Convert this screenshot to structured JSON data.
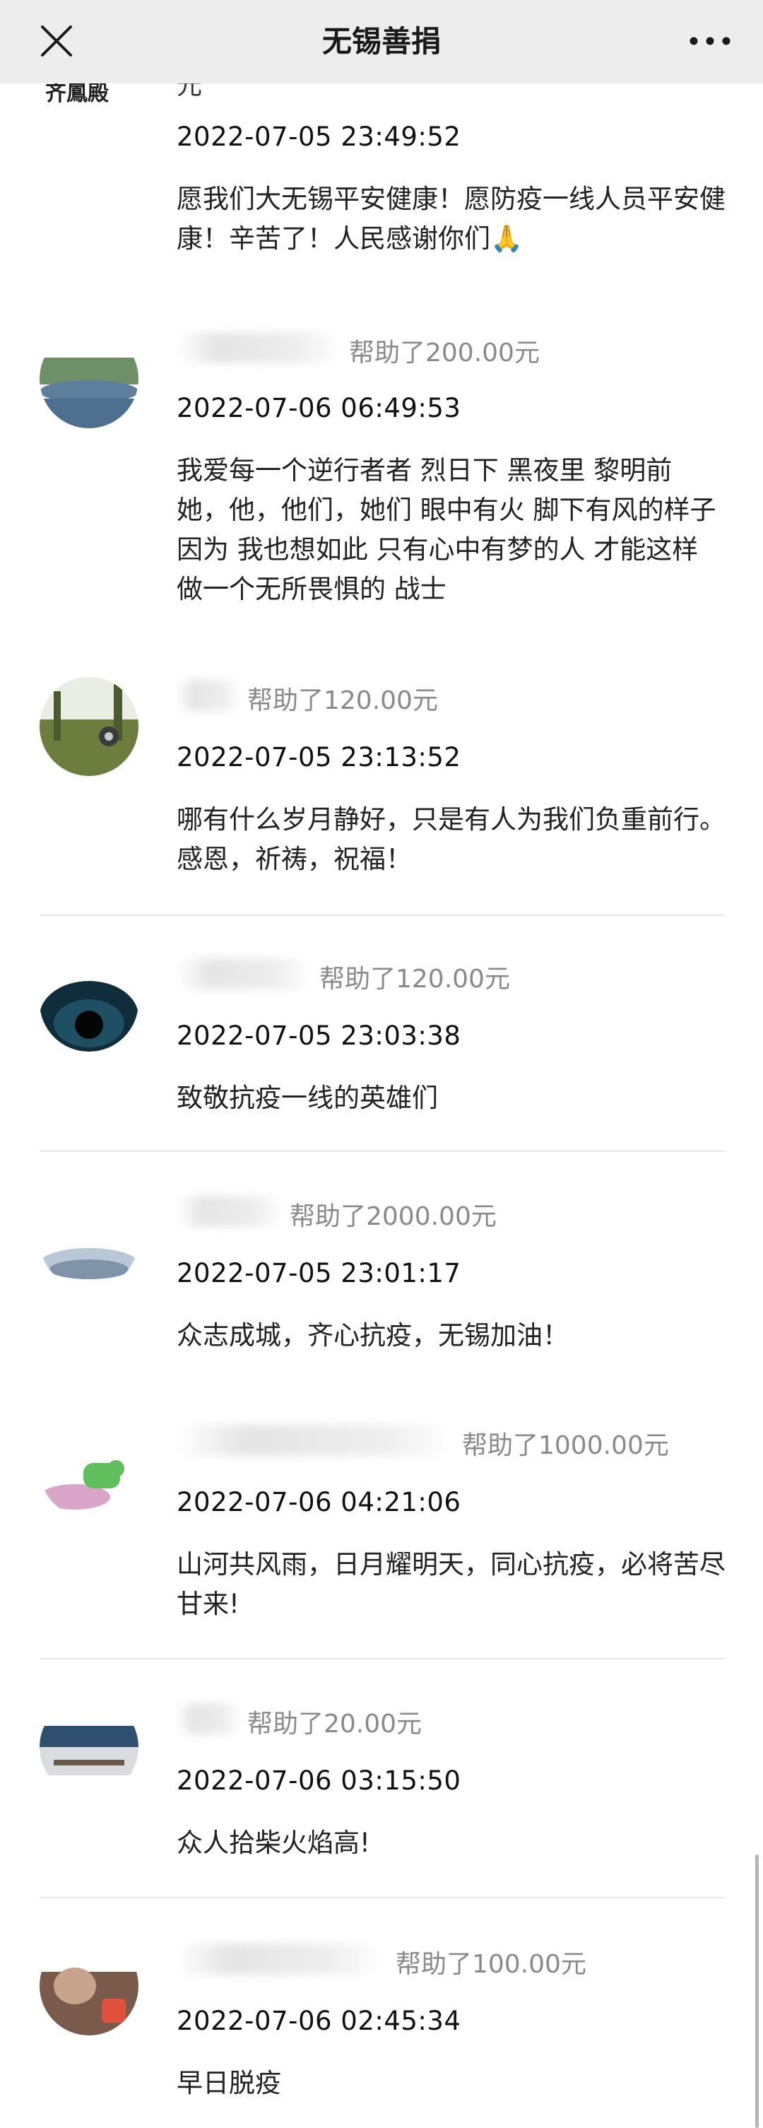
{
  "header": {
    "title": "无锡善捐",
    "close_icon": "close-icon",
    "more_icon": "more-icon"
  },
  "top_partial": {
    "logo_text": "齐鳳殿",
    "leftover_text": "元",
    "time": "2022-07-05 23:49:52",
    "message": "愿我们大无锡平安健康！愿防疫一线人员平安健康！辛苦了！人民感谢你们🙏"
  },
  "entries": [
    {
      "donation": "帮助了200.00元",
      "time": "2022-07-06 06:49:53",
      "message": "我爱每一个逆行者者 烈日下 黑夜里 黎明前 她，他，他们，她们 眼中有火 脚下有风的样子 因为 我也想如此 只有心中有梦的人 才能这样 做一个无所畏惧的 战士"
    },
    {
      "donation": "帮助了120.00元",
      "time": "2022-07-05 23:13:52",
      "message": "哪有什么岁月静好，只是有人为我们负重前行。感恩，祈祷，祝福！"
    },
    {
      "donation": "帮助了120.00元",
      "time": "2022-07-05 23:03:38",
      "message": "致敬抗疫一线的英雄们"
    },
    {
      "donation": "帮助了2000.00元",
      "time": "2022-07-05 23:01:17",
      "message": "众志成城，齐心抗疫，无锡加油！"
    },
    {
      "donation": "帮助了1000.00元",
      "time": "2022-07-06 04:21:06",
      "message": "山河共风雨，日月耀明天，同心抗疫，必将苦尽甘来!"
    },
    {
      "donation": "帮助了20.00元",
      "time": "2022-07-06 03:15:50",
      "message": "众人拾柴火焰高!"
    },
    {
      "donation": "帮助了100.00元",
      "time": "2022-07-06 02:45:34",
      "message": "早日脱疫"
    }
  ]
}
